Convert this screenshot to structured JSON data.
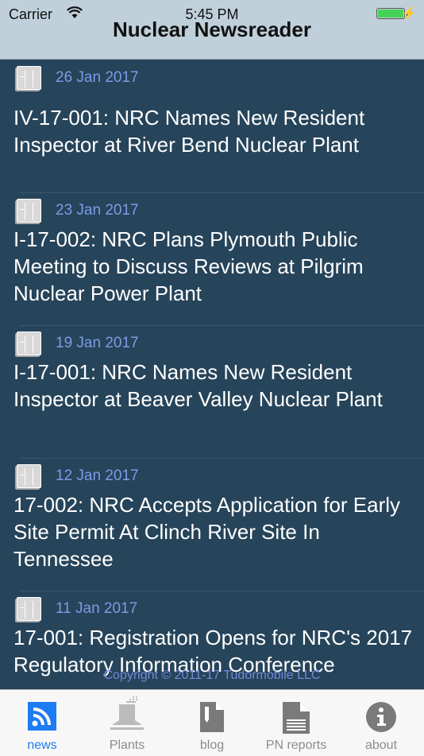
{
  "status_bar": {
    "carrier": "Carrier",
    "time": "5:45 PM",
    "battery_color": "#44d356"
  },
  "header": {
    "title": "Nuclear Newsreader"
  },
  "news": [
    {
      "date": "26 Jan 2017",
      "headline": "IV-17-001: NRC Names New Resident Inspector at River Bend Nuclear Plant"
    },
    {
      "date": "23 Jan 2017",
      "headline": "I-17-002: NRC Plans Plymouth Public Meeting to Discuss Reviews at Pilgrim Nuclear Power Plant"
    },
    {
      "date": "19 Jan 2017",
      "headline": "I-17-001: NRC  Names New Resident Inspector at Beaver Valley Nuclear Plant"
    },
    {
      "date": "12 Jan 2017",
      "headline": "17-002: NRC Accepts Application for Early Site Permit At Clinch River Site In Tennessee"
    },
    {
      "date": "11 Jan 2017",
      "headline": "17-001: Registration Opens for NRC's 2017 Regulatory Information Conference"
    }
  ],
  "footer": {
    "copyright": "Copyright © 2011-17 Tudormobile LLC"
  },
  "tabs": [
    {
      "label": "news",
      "icon": "rss-icon",
      "active": true
    },
    {
      "label": "Plants",
      "icon": "plant-icon",
      "active": false
    },
    {
      "label": "blog",
      "icon": "blog-icon",
      "active": false
    },
    {
      "label": "PN reports",
      "icon": "document-icon",
      "active": false
    },
    {
      "label": "about",
      "icon": "info-icon",
      "active": false
    }
  ],
  "colors": {
    "accent": "#1e7cf2",
    "list_bg": "#26445a",
    "date": "#7f9ae6"
  }
}
